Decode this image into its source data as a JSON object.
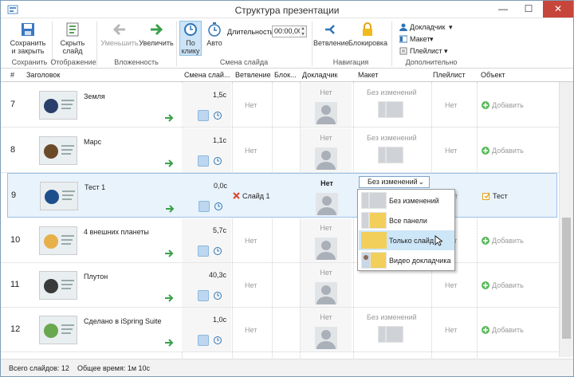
{
  "window": {
    "title": "Структура презентации",
    "minimize": "—",
    "maximize": "☐",
    "close": "✕"
  },
  "ribbon": {
    "save_close": "Сохранить и закрыть",
    "save_group": "Сохранить",
    "hide_slide": "Скрыть слайд",
    "view_group": "Отображение",
    "decrease": "Уменьшить",
    "increase": "Увеличить",
    "nesting_group": "Вложенность",
    "on_click": "По клику",
    "auto": "Авто",
    "duration_label": "Длительность:",
    "duration_value": "00:00,00",
    "transition_group": "Смена слайда",
    "branching": "Ветвление",
    "lock": "Блокировка",
    "navigation_group": "Навигация",
    "presenter": "Докладчик",
    "layout": "Макет",
    "playlist": "Плейлист",
    "extra_group": "Дополнительно"
  },
  "columns": [
    "#",
    "Заголовок",
    "Смена слай...",
    "Ветвление",
    "Блок...",
    "Докладчик",
    "Макет",
    "Плейлист",
    "Объект"
  ],
  "rows": [
    {
      "num": "7",
      "title": "Земля",
      "time": "1,5с",
      "branch": "Нет",
      "presenter": "Нет",
      "layout": "Без изменений",
      "playlist": "Нет",
      "object": "Добавить",
      "thumb_color": "#2b3f6b"
    },
    {
      "num": "8",
      "title": "Марс",
      "time": "1,1с",
      "branch": "Нет",
      "presenter": "Нет",
      "layout": "Без изменений",
      "playlist": "Нет",
      "object": "Добавить",
      "thumb_color": "#6b4a2a"
    },
    {
      "num": "9",
      "title": "Тест 1",
      "time": "0,0с",
      "branch": "Слайд 1",
      "presenter": "Нет",
      "layout": "Без изменений",
      "playlist": "Нет",
      "object": "Тест",
      "thumb_color": "#1d4f8c"
    },
    {
      "num": "10",
      "title": "4 внешних планеты",
      "time": "5,7с",
      "branch": "Нет",
      "presenter": "Нет",
      "layout": "",
      "playlist": "Нет",
      "object": "Добавить",
      "thumb_color": "#e8b04a"
    },
    {
      "num": "11",
      "title": "Плутон",
      "time": "40,3с",
      "branch": "Нет",
      "presenter": "Нет",
      "layout": "",
      "playlist": "Нет",
      "object": "Добавить",
      "thumb_color": "#3a3a3a"
    },
    {
      "num": "12",
      "title": "Сделано в iSpring Suite",
      "time": "1,0с",
      "branch": "Нет",
      "presenter": "Нет",
      "layout": "Без изменений",
      "playlist": "Нет",
      "object": "Добавить",
      "thumb_color": "#6aa84f"
    }
  ],
  "dropdown": {
    "current": "Без изменений",
    "options": [
      "Без изменений",
      "Все панели",
      "Только слайд",
      "Видео докладчика"
    ],
    "highlighted": "Только слайд"
  },
  "status": {
    "total_slides": "Всего слайдов: 12",
    "total_time": "Общее время:  1м 10с"
  },
  "colors": {
    "accent": "#2e75b6",
    "selected_row": "#e9f3fc",
    "green_arrow": "#3aa14a",
    "add_green": "#5cb85c"
  }
}
